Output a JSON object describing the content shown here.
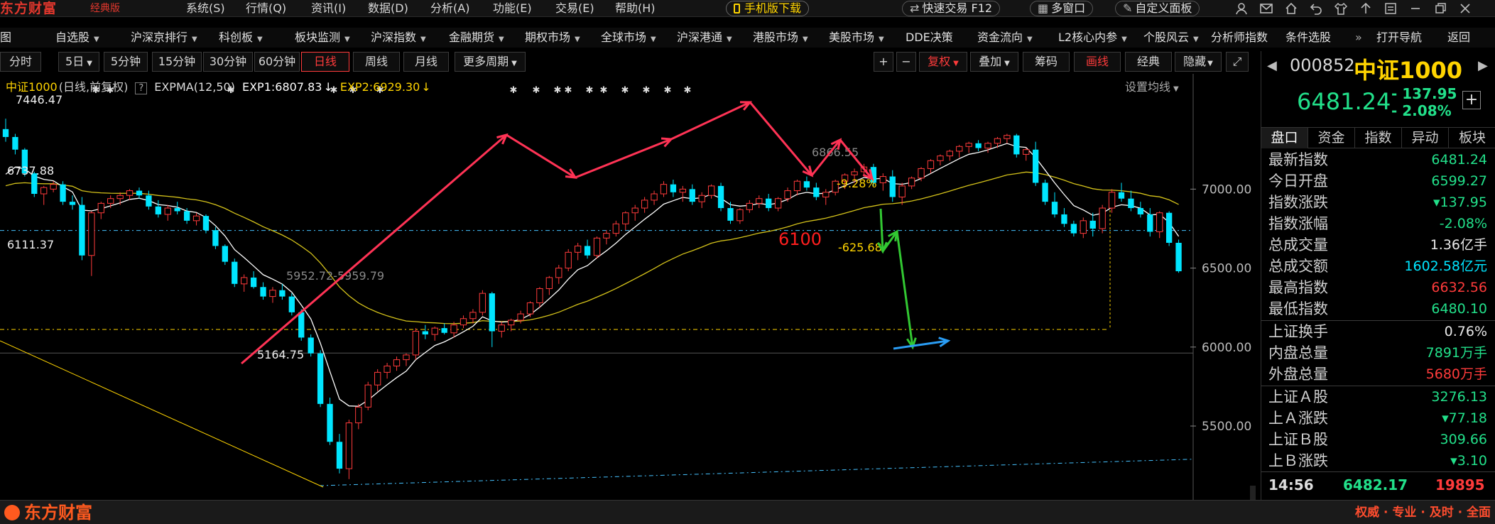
{
  "app": {
    "logo": "东方财富",
    "edition": "经典版"
  },
  "menu": [
    "系统(S)",
    "行情(Q)",
    "资讯(I)",
    "数据(D)",
    "分析(A)",
    "功能(E)",
    "交易(E)",
    "帮助(H)"
  ],
  "toolbar": {
    "mobile": "手机版下载",
    "quick_trade": "快速交易 F12",
    "multi_window": "多窗口",
    "custom_panel": "自定义面板"
  },
  "nav": [
    "自选股",
    "沪深京排行",
    "科创板",
    "板块监测",
    "沪深指数",
    "金融期货",
    "期权市场",
    "全球市场",
    "沪深港通",
    "港股市场",
    "美股市场",
    "DDE决策",
    "资金流向",
    "L2核心内参",
    "个股风云",
    "分析师指数",
    "条件选股",
    "打开导航",
    "返回"
  ],
  "nav_first_fragment": "图",
  "nav_more": "»",
  "periods": [
    "分时",
    "5日",
    "5分钟",
    "15分钟",
    "30分钟",
    "60分钟",
    "日线",
    "周线",
    "月线",
    "更多周期"
  ],
  "period_active": "日线",
  "chart_tools": {
    "plus": "+",
    "minus": "−",
    "fuquan": "复权",
    "overlay": "叠加",
    "chips": "筹码",
    "draw": "画线",
    "classic": "经典",
    "hide": "隐藏"
  },
  "indicator": {
    "name": "中证1000",
    "desc": "(日线,前复权)",
    "help": "?",
    "expma": "EXPMA(12,50)",
    "exp1": "EXP1:6807.83",
    "exp2": "EXP2:6929.30",
    "setting": "设置均线"
  },
  "colors": {
    "up": "#ff3b3b",
    "down": "#00e5ff",
    "exp1": "#ffffff",
    "exp2": "#ffd400",
    "accent_green": "#22e08a",
    "arrow_red": "#ff3355",
    "arrow_green": "#32c832",
    "arrow_blue": "#2a9df4"
  },
  "chart_data": {
    "type": "candlestick",
    "y_axis": {
      "ylim": [
        5100,
        7550
      ],
      "ticks": [
        "7000.00",
        "6500.00",
        "6000.00",
        "5500.00"
      ],
      "tick_values": [
        7000,
        6500,
        6000,
        5500
      ]
    },
    "annotations": {
      "high_label": "7446.47",
      "level_6737": "6737.88",
      "level_6111": "6111.37",
      "low_label": "5164.75",
      "range_label": "5952.72-5959.79",
      "right_label": "6866.55",
      "pct_label": "-9.28%",
      "diff_label": "-625.68",
      "target_label": "6100"
    },
    "level_lines": [
      6737.88,
      6111.37
    ],
    "ohlc": [
      [
        7380,
        7446,
        7300,
        7330
      ],
      [
        7330,
        7350,
        7220,
        7250
      ],
      [
        7250,
        7260,
        7080,
        7100
      ],
      [
        7100,
        7110,
        6950,
        6970
      ],
      [
        6970,
        7020,
        6900,
        7010
      ],
      [
        7000,
        7050,
        6980,
        7030
      ],
      [
        7030,
        7050,
        6900,
        6920
      ],
      [
        6920,
        6960,
        6870,
        6900
      ],
      [
        6900,
        6950,
        6550,
        6580
      ],
      [
        6580,
        6860,
        6450,
        6850
      ],
      [
        6850,
        6920,
        6810,
        6910
      ],
      [
        6910,
        6960,
        6880,
        6940
      ],
      [
        6940,
        6980,
        6900,
        6960
      ],
      [
        6960,
        7000,
        6930,
        6990
      ],
      [
        6990,
        7010,
        6940,
        6960
      ],
      [
        6960,
        6990,
        6870,
        6890
      ],
      [
        6890,
        6930,
        6820,
        6840
      ],
      [
        6840,
        6900,
        6800,
        6880
      ],
      [
        6880,
        6920,
        6840,
        6860
      ],
      [
        6860,
        6880,
        6780,
        6800
      ],
      [
        6800,
        6850,
        6770,
        6830
      ],
      [
        6830,
        6840,
        6720,
        6740
      ],
      [
        6740,
        6760,
        6620,
        6640
      ],
      [
        6640,
        6650,
        6520,
        6540
      ],
      [
        6540,
        6560,
        6380,
        6400
      ],
      [
        6400,
        6460,
        6350,
        6440
      ],
      [
        6440,
        6480,
        6370,
        6380
      ],
      [
        6380,
        6410,
        6300,
        6320
      ],
      [
        6320,
        6380,
        6280,
        6360
      ],
      [
        6360,
        6400,
        6300,
        6320
      ],
      [
        6320,
        6340,
        6200,
        6220
      ],
      [
        6220,
        6240,
        6040,
        6060
      ],
      [
        6060,
        6080,
        5940,
        5960
      ],
      [
        5960,
        5980,
        5620,
        5640
      ],
      [
        5640,
        5680,
        5380,
        5400
      ],
      [
        5400,
        5450,
        5200,
        5230
      ],
      [
        5230,
        5540,
        5164,
        5520
      ],
      [
        5520,
        5640,
        5480,
        5620
      ],
      [
        5620,
        5780,
        5600,
        5760
      ],
      [
        5760,
        5860,
        5720,
        5840
      ],
      [
        5840,
        5900,
        5800,
        5880
      ],
      [
        5880,
        5940,
        5850,
        5920
      ],
      [
        5920,
        5960,
        5880,
        5950
      ],
      [
        5950,
        6120,
        5920,
        6100
      ],
      [
        6100,
        6140,
        6050,
        6080
      ],
      [
        6080,
        6130,
        6040,
        6120
      ],
      [
        6120,
        6150,
        6080,
        6090
      ],
      [
        6090,
        6160,
        6060,
        6140
      ],
      [
        6140,
        6200,
        6120,
        6180
      ],
      [
        6180,
        6240,
        6150,
        6220
      ],
      [
        6220,
        6360,
        6200,
        6340
      ],
      [
        6340,
        6350,
        6000,
        6100
      ],
      [
        6100,
        6160,
        6060,
        6140
      ],
      [
        6140,
        6180,
        6100,
        6170
      ],
      [
        6170,
        6230,
        6150,
        6210
      ],
      [
        6210,
        6290,
        6190,
        6280
      ],
      [
        6280,
        6380,
        6250,
        6370
      ],
      [
        6370,
        6450,
        6330,
        6440
      ],
      [
        6440,
        6520,
        6400,
        6500
      ],
      [
        6500,
        6620,
        6480,
        6600
      ],
      [
        6600,
        6660,
        6550,
        6640
      ],
      [
        6640,
        6680,
        6560,
        6580
      ],
      [
        6580,
        6700,
        6560,
        6690
      ],
      [
        6690,
        6740,
        6650,
        6720
      ],
      [
        6720,
        6800,
        6700,
        6780
      ],
      [
        6780,
        6860,
        6740,
        6850
      ],
      [
        6850,
        6900,
        6800,
        6880
      ],
      [
        6880,
        6950,
        6850,
        6930
      ],
      [
        6930,
        6990,
        6900,
        6970
      ],
      [
        6970,
        7050,
        6950,
        7030
      ],
      [
        7030,
        7060,
        6950,
        6980
      ],
      [
        6980,
        7020,
        6920,
        7000
      ],
      [
        7000,
        7030,
        6900,
        6920
      ],
      [
        6920,
        6980,
        6880,
        6960
      ],
      [
        6960,
        7030,
        6940,
        7020
      ],
      [
        7020,
        7040,
        6860,
        6880
      ],
      [
        6880,
        6920,
        6780,
        6800
      ],
      [
        6800,
        6880,
        6780,
        6870
      ],
      [
        6870,
        6930,
        6850,
        6910
      ],
      [
        6910,
        6960,
        6880,
        6940
      ],
      [
        6940,
        6970,
        6860,
        6880
      ],
      [
        6880,
        6950,
        6860,
        6940
      ],
      [
        6940,
        7010,
        6920,
        6990
      ],
      [
        6990,
        7060,
        6960,
        7050
      ],
      [
        7050,
        7080,
        6990,
        7010
      ],
      [
        7010,
        7040,
        6930,
        6950
      ],
      [
        6950,
        7000,
        6900,
        6980
      ],
      [
        6980,
        7060,
        6960,
        7050
      ],
      [
        7050,
        7100,
        7000,
        7090
      ],
      [
        7090,
        7130,
        7040,
        7110
      ],
      [
        7110,
        7160,
        7080,
        7140
      ],
      [
        7140,
        7160,
        7020,
        7040
      ],
      [
        7040,
        7100,
        6990,
        7080
      ],
      [
        7080,
        7120,
        6920,
        6950
      ],
      [
        6950,
        7040,
        6900,
        7020
      ],
      [
        7020,
        7080,
        7000,
        7070
      ],
      [
        7070,
        7140,
        7050,
        7130
      ],
      [
        7130,
        7190,
        7100,
        7180
      ],
      [
        7180,
        7220,
        7150,
        7210
      ],
      [
        7210,
        7250,
        7180,
        7240
      ],
      [
        7240,
        7280,
        7200,
        7270
      ],
      [
        7270,
        7300,
        7230,
        7290
      ],
      [
        7290,
        7310,
        7240,
        7260
      ],
      [
        7260,
        7300,
        7230,
        7290
      ],
      [
        7290,
        7330,
        7260,
        7320
      ],
      [
        7320,
        7350,
        7290,
        7340
      ],
      [
        7340,
        7350,
        7200,
        7220
      ],
      [
        7220,
        7260,
        7180,
        7250
      ],
      [
        7250,
        7300,
        7020,
        7040
      ],
      [
        7040,
        7060,
        6900,
        6920
      ],
      [
        6920,
        6980,
        6820,
        6840
      ],
      [
        6840,
        6880,
        6760,
        6780
      ],
      [
        6780,
        6800,
        6700,
        6720
      ],
      [
        6720,
        6820,
        6690,
        6800
      ],
      [
        6800,
        6850,
        6700,
        6750
      ],
      [
        6750,
        6900,
        6720,
        6880
      ],
      [
        6880,
        7000,
        6850,
        6980
      ],
      [
        6980,
        7040,
        6920,
        6940
      ],
      [
        6940,
        6990,
        6860,
        6880
      ],
      [
        6880,
        6920,
        6820,
        6840
      ],
      [
        6840,
        6880,
        6700,
        6730
      ],
      [
        6730,
        6860,
        6690,
        6850
      ],
      [
        6850,
        6860,
        6640,
        6660
      ],
      [
        6660,
        6680,
        6470,
        6480
      ]
    ]
  },
  "right_panel": {
    "code": "000852",
    "name": "中证1000",
    "price": "6481.24",
    "change": "- 137.95",
    "change_pct": "- 2.08%",
    "tabs": [
      "盘口",
      "资金",
      "指数",
      "异动",
      "板块"
    ],
    "rows": [
      {
        "label": "最新指数",
        "value": "6481.24",
        "color": "#22e08a"
      },
      {
        "label": "今日开盘",
        "value": "6599.27",
        "color": "#22e08a"
      },
      {
        "label": "指数涨跌",
        "value": "▾137.95",
        "color": "#22e08a"
      },
      {
        "label": "指数涨幅",
        "value": "-2.08%",
        "color": "#22e08a"
      },
      {
        "label": "总成交量",
        "value": "1.36亿手",
        "color": "#e8e8e8"
      },
      {
        "label": "总成交额",
        "value": "1602.58亿元",
        "color": "#00e5ff"
      },
      {
        "label": "最高指数",
        "value": "6632.56",
        "color": "#ff3b3b"
      },
      {
        "label": "最低指数",
        "value": "6480.10",
        "color": "#22e08a"
      }
    ],
    "rows2": [
      {
        "label": "上证换手",
        "value": "0.76%",
        "color": "#e8e8e8"
      },
      {
        "label": "内盘总量",
        "value": "7891万手",
        "color": "#22e08a"
      },
      {
        "label": "外盘总量",
        "value": "5680万手",
        "color": "#ff3b3b"
      }
    ],
    "rows3": [
      {
        "label": "上证Ａ股",
        "value": "3276.13",
        "color": "#22e08a"
      },
      {
        "label": "上Ａ涨跌",
        "value": "▾77.18",
        "color": "#22e08a"
      },
      {
        "label": "上证Ｂ股",
        "value": "309.66",
        "color": "#22e08a"
      },
      {
        "label": "上Ｂ涨跌",
        "value": "▾3.10",
        "color": "#22e08a"
      }
    ],
    "footer": {
      "time": "14:56",
      "price": "6482.17",
      "volume": "19895"
    }
  },
  "statusbar": {
    "logo": "东方财富",
    "slogan": "权威 · 专业 · 及时 · 全面"
  }
}
